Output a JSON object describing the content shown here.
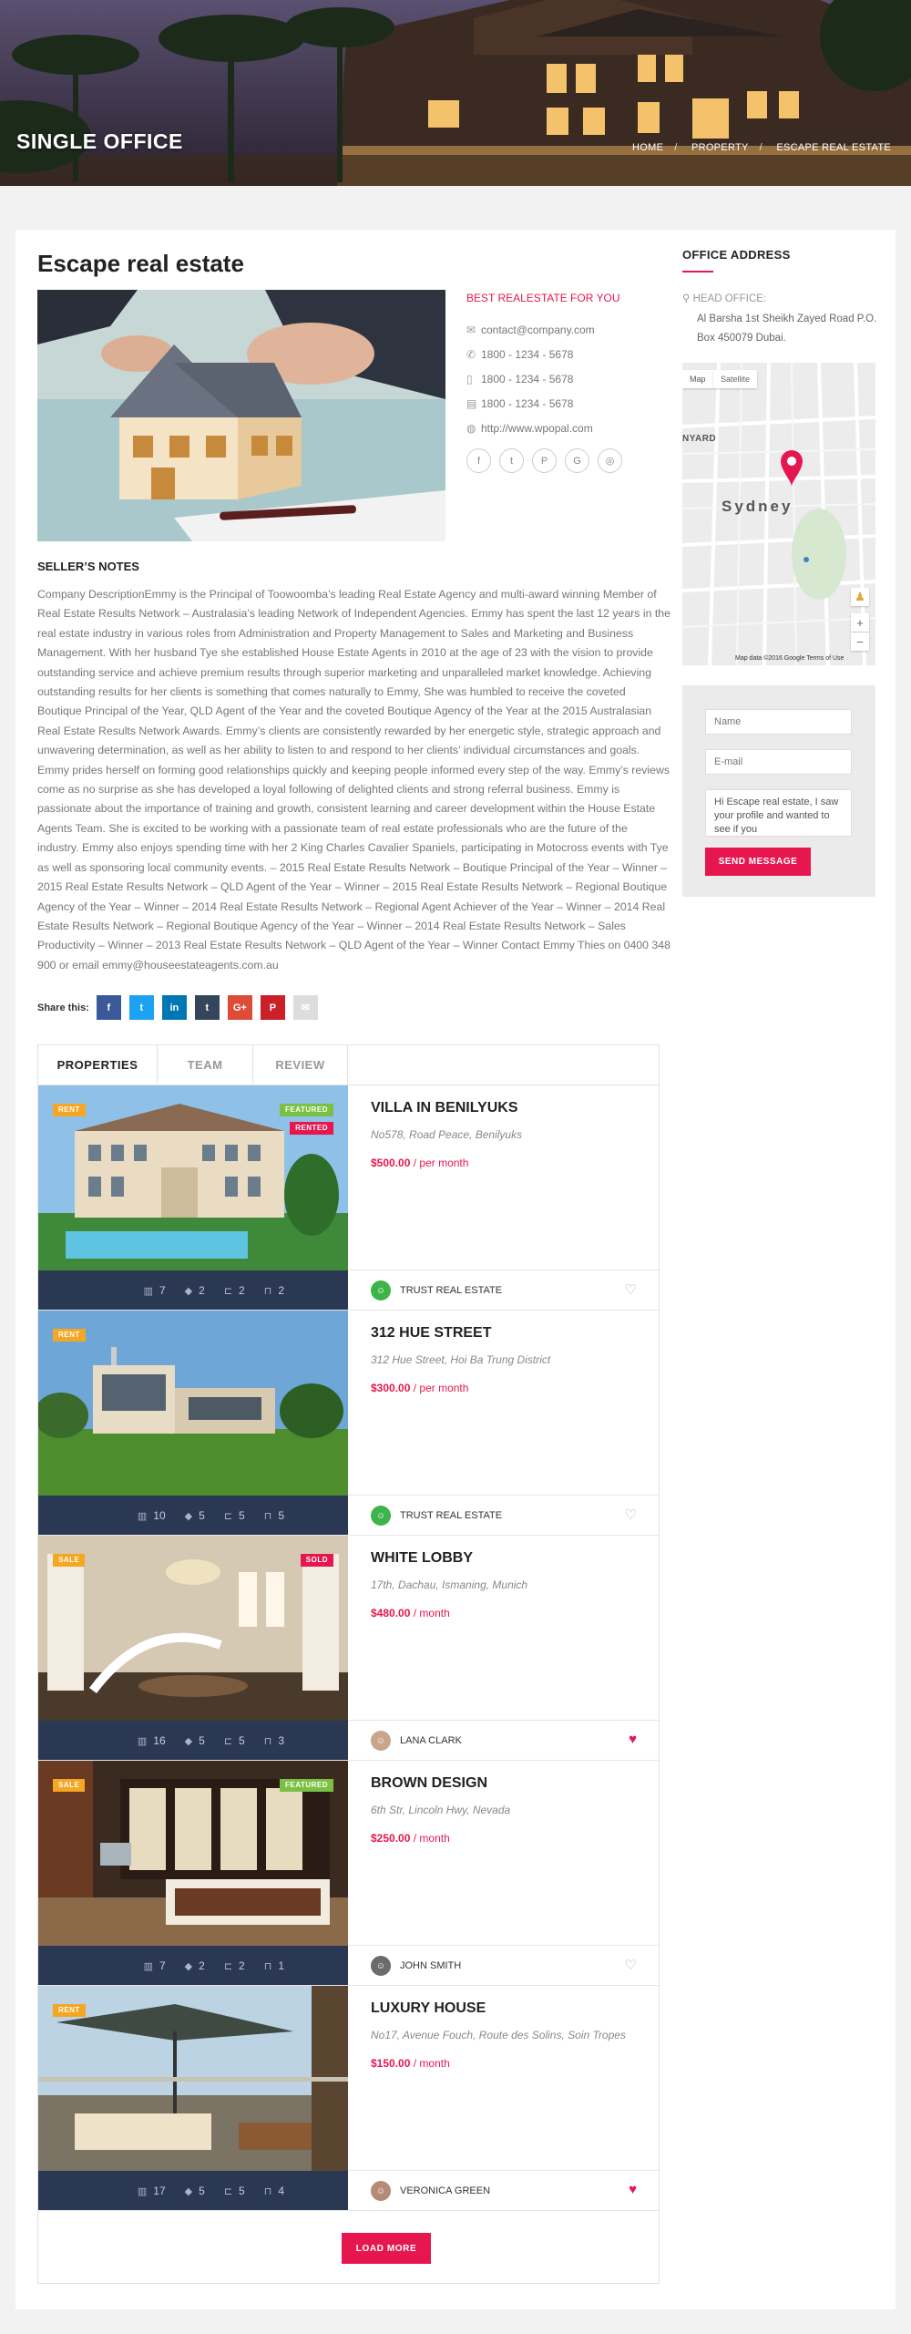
{
  "header": {
    "title": "SINGLE OFFICE",
    "breadcrumb": [
      "HOME",
      "PROPERTY",
      "ESCAPE REAL ESTATE"
    ]
  },
  "office": {
    "name": "Escape real estate",
    "tagline": "BEST REALESTATE FOR YOU",
    "email": "contact@company.com",
    "phone": "1800 - 1234 - 5678",
    "mobile": "1800 - 1234 - 5678",
    "fax": "1800 - 1234 - 5678",
    "website": "http://www.wpopal.com",
    "socials": [
      "facebook-icon",
      "twitter-icon",
      "pinterest-icon",
      "google-icon",
      "instagram-icon"
    ]
  },
  "notes": {
    "heading": "SELLER’S NOTES",
    "text": "Company DescriptionEmmy is the Principal of Toowoomba’s leading Real Estate Agency and multi-award winning Member of Real Estate Results Network – Australasia’s leading Network of Independent Agencies. Emmy has spent the last 12 years in the real estate industry in various roles from Administration and Property Management to Sales and Marketing and Business Management. With her husband Tye she established House Estate Agents in 2010 at the age of 23 with the vision to provide outstanding service and achieve premium results through superior marketing and unparalleled market knowledge. Achieving outstanding results for her clients is something that comes naturally to Emmy, She was humbled to receive the coveted Boutique Principal of the Year, QLD Agent of the Year and the coveted Boutique Agency of the Year at the 2015 Australasian Real Estate Results Network Awards. Emmy’s clients are consistently rewarded by her energetic style, strategic approach and unwavering determination, as well as her ability to listen to and respond to her clients’ individual circumstances and goals. Emmy prides herself on forming good relationships quickly and keeping people informed every step of the way. Emmy’s reviews come as no surprise as she has developed a loyal following of delighted clients and strong referral business. Emmy is passionate about the importance of training and growth, consistent learning and career development within the House Estate Agents Team. She is excited to be working with a passionate team of real estate professionals who are the future of the industry. Emmy also enjoys spending time with her 2 King Charles Cavalier Spaniels, participating in Motocross events with Tye as well as sponsoring local community events. – 2015 Real Estate Results Network – Boutique Principal of the Year – Winner – 2015 Real Estate Results Network – QLD Agent of the Year – Winner – 2015 Real Estate Results Network – Regional Boutique Agency of the Year – Winner – 2014 Real Estate Results Network – Regional Agent Achiever of the Year – Winner – 2014 Real Estate Results Network – Regional Boutique Agency of the Year – Winner – 2014 Real Estate Results Network – Sales Productivity – Winner – 2013 Real Estate Results Network – QLD Agent of the Year – Winner Contact Emmy Thies on 0400 348 900 or email emmy@houseestateagents.com.au"
  },
  "share": {
    "label": "Share this:",
    "buttons": [
      {
        "icon": "facebook-icon",
        "glyph": "f",
        "color": "#3b5998"
      },
      {
        "icon": "twitter-icon",
        "glyph": "t",
        "color": "#1da1f2"
      },
      {
        "icon": "linkedin-icon",
        "glyph": "in",
        "color": "#0077b5"
      },
      {
        "icon": "tumblr-icon",
        "glyph": "t",
        "color": "#35465c"
      },
      {
        "icon": "googleplus-icon",
        "glyph": "G+",
        "color": "#dd4b39"
      },
      {
        "icon": "pinterest-icon",
        "glyph": "P",
        "color": "#cb2027"
      },
      {
        "icon": "email-icon",
        "glyph": "✉",
        "color": "#dddddd"
      }
    ]
  },
  "tabs": [
    "PROPERTIES",
    "TEAM",
    "REVIEW"
  ],
  "properties": [
    {
      "name": "VILLA IN BENILYUKS",
      "address": "No578, Road Peace, Benilyuks",
      "price": "$500.00",
      "period": "/ per month",
      "status": "RENT",
      "featured": true,
      "rented": true,
      "sold": false,
      "stats": {
        "area": "7",
        "baths": "2",
        "beds": "2",
        "garages": "2"
      },
      "agent": "TRUST REAL ESTATE",
      "agent_color": "#3eb34a",
      "favorited": false
    },
    {
      "name": "312 HUE STREET",
      "address": "312 Hue Street, Hoi Ba Trung District",
      "price": "$300.00",
      "period": "/ per month",
      "status": "RENT",
      "featured": false,
      "rented": false,
      "sold": false,
      "stats": {
        "area": "10",
        "baths": "5",
        "beds": "5",
        "garages": "5"
      },
      "agent": "TRUST REAL ESTATE",
      "agent_color": "#3eb34a",
      "favorited": false
    },
    {
      "name": "WHITE LOBBY",
      "address": "17th, Dachau, Ismaning, Munich",
      "price": "$480.00",
      "period": "/ month",
      "status": "SALE",
      "featured": false,
      "rented": false,
      "sold": true,
      "stats": {
        "area": "16",
        "baths": "5",
        "beds": "5",
        "garages": "3"
      },
      "agent": "LANA CLARK",
      "agent_color": "#c9a58a",
      "favorited": true
    },
    {
      "name": "BROWN DESIGN",
      "address": "6th Str, Lincoln Hwy, Nevada",
      "price": "$250.00",
      "period": "/ month",
      "status": "SALE",
      "featured": true,
      "rented": false,
      "sold": false,
      "stats": {
        "area": "7",
        "baths": "2",
        "beds": "2",
        "garages": "1"
      },
      "agent": "JOHN SMITH",
      "agent_color": "#6b6b6b",
      "favorited": false
    },
    {
      "name": "LUXURY HOUSE",
      "address": "No17, Avenue Fouch, Route des Solins, Soin Tropes",
      "price": "$150.00",
      "period": "/ month",
      "status": "RENT",
      "featured": false,
      "rented": false,
      "sold": false,
      "stats": {
        "area": "17",
        "baths": "5",
        "beds": "5",
        "garages": "4"
      },
      "agent": "VERONICA GREEN",
      "agent_color": "#b58a78",
      "favorited": true
    }
  ],
  "badges": {
    "featured": "FEATURED",
    "rented": "RENTED",
    "sold": "SOLD"
  },
  "load_more": "LOAD MORE",
  "sidebar": {
    "heading": "OFFICE ADDRESS",
    "head_label": "HEAD OFFICE:",
    "address": "Al Barsha 1st Sheikh Zayed Road P.O. Box 450079 Dubai.",
    "map": {
      "tab_map": "Map",
      "tab_satellite": "Satellite",
      "city": "Sydney",
      "district": "NYARD",
      "footer": "Map data ©2016 Google    Terms of Use",
      "zoom_in": "+",
      "zoom_out": "−"
    },
    "form": {
      "name_placeholder": "Name",
      "email_placeholder": "E-mail",
      "message": "Hi Escape real estate, I saw your profile and wanted to see if you",
      "send": "SEND MESSAGE"
    }
  },
  "colors": {
    "accent": "#e6174f",
    "navy": "#2a3853",
    "rent": "#f5a623",
    "featured": "#7ac143"
  }
}
